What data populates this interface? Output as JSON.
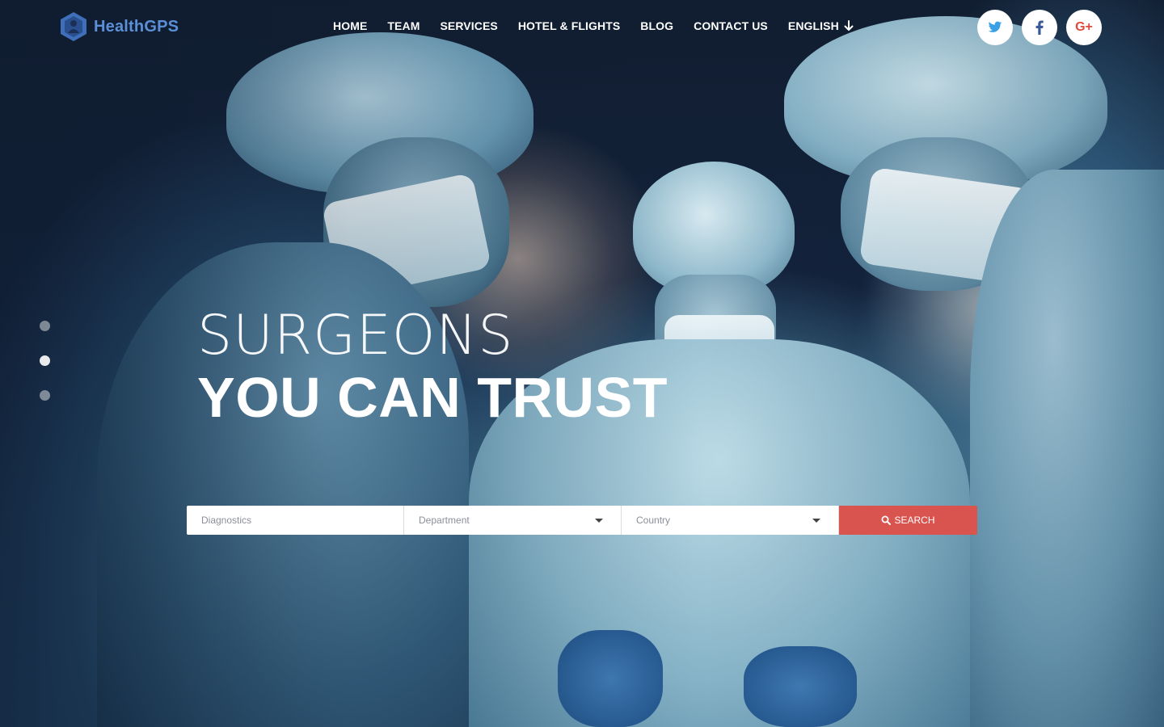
{
  "brand": {
    "name": "HealthGPS",
    "accent": "#5b8fd6"
  },
  "nav": {
    "items": [
      {
        "label": "HOME"
      },
      {
        "label": "TEAM"
      },
      {
        "label": "SERVICES"
      },
      {
        "label": "HOTEL & FLIGHTS"
      },
      {
        "label": "BLOG"
      },
      {
        "label": "CONTACT US"
      }
    ],
    "language": {
      "label": "ENGLISH",
      "icon": "arrow-down-icon"
    }
  },
  "social": [
    {
      "name": "twitter",
      "icon": "twitter-icon",
      "color": "#3aa0e6"
    },
    {
      "name": "facebook",
      "icon": "facebook-icon",
      "color": "#3b5998"
    },
    {
      "name": "google-plus",
      "icon": "google-plus-icon",
      "label": "G+",
      "color": "#e04a3a"
    }
  ],
  "slider": {
    "dots": 3,
    "active_index": 1
  },
  "hero": {
    "headline_light": "SURGEONS",
    "headline_bold": "YOU CAN TRUST"
  },
  "search": {
    "diagnostics_placeholder": "Diagnostics",
    "department_value": "Department",
    "country_value": "Country",
    "button_label": "SEARCH",
    "button_color": "#d9534f"
  }
}
